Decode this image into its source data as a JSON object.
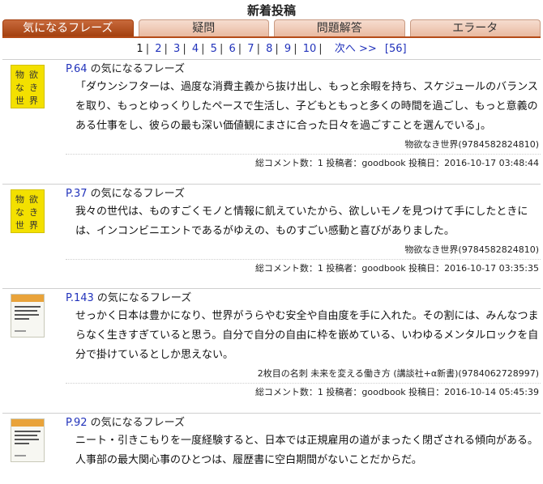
{
  "page": {
    "title": "新着投稿"
  },
  "tabs": [
    {
      "label": "気になるフレーズ"
    },
    {
      "label": "疑問"
    },
    {
      "label": "問題解答"
    },
    {
      "label": "エラータ"
    }
  ],
  "pager": {
    "pages": [
      "1",
      "2",
      "3",
      "4",
      "5",
      "6",
      "7",
      "8",
      "9",
      "10"
    ],
    "next_label": "次へ >>",
    "total_label": "[56]"
  },
  "entries": [
    {
      "page_label": "P.64",
      "head_suffix": " の気になるフレーズ",
      "text": "「ダウンシフターは、過度な消費主義から抜け出し、もっと余暇を持ち、スケジュールのバランスを取り、もっとゆっくりしたペースで生活し、子どもともっと多くの時間を過ごし、もっと意義のある仕事をし、彼らの最も深い価値観にまさに合った日々を過ごすことを選んでいる」。",
      "book": "物欲なき世界(9784582824810)",
      "meta": "総コメント数：1 投稿者：goodbook 投稿日：2016-10-17 03:48:44",
      "thumb": "yellow",
      "thumb_text": [
        "物",
        "欲",
        "な",
        "き",
        "世",
        "界"
      ]
    },
    {
      "page_label": "P.37",
      "head_suffix": " の気になるフレーズ",
      "text": "我々の世代は、ものすごくモノと情報に飢えていたから、欲しいモノを見つけて手にしたときには、インコンビニエントであるがゆえの、ものすごい感動と喜びがありました。",
      "book": "物欲なき世界(9784582824810)",
      "meta": "総コメント数：1 投稿者：goodbook 投稿日：2016-10-17 03:35:35",
      "thumb": "yellow",
      "thumb_text": [
        "物",
        "欲",
        "な",
        "き",
        "世",
        "界"
      ]
    },
    {
      "page_label": "P.143",
      "head_suffix": " の気になるフレーズ",
      "text": "せっかく日本は豊かになり、世界がうらやむ安全や自由度を手に入れた。その割には、みんなつまらなく生きすぎていると思う。自分で自分の自由に枠を嵌めている、いわゆるメンタルロックを自分で掛けているとしか思えない。",
      "book": "2枚目の名刺 未来を変える働き方 (講談社+α新書)(9784062728997)",
      "meta": "総コメント数：1 投稿者：goodbook 投稿日：2016-10-14 05:45:39",
      "thumb": "white",
      "thumb_text": []
    },
    {
      "page_label": "P.92",
      "head_suffix": " の気になるフレーズ",
      "text": "ニート・引きこもりを一度経験すると、日本では正規雇用の道がまったく閉ざされる傾向がある。人事部の最大関心事のひとつは、履歴書に空白期間がないことだからだ。",
      "book": "",
      "meta": "",
      "thumb": "white",
      "thumb_text": []
    }
  ]
}
